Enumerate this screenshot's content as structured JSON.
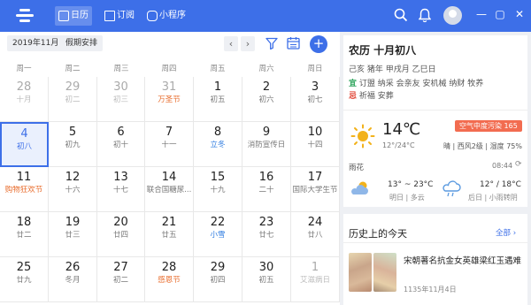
{
  "app": {
    "tabs": [
      {
        "label": "日历",
        "icon": "calendar-check-icon"
      },
      {
        "label": "订阅",
        "icon": "subscribe-icon"
      },
      {
        "label": "小程序",
        "icon": "mini-program-icon"
      }
    ],
    "window_buttons": {
      "minimize": "—",
      "restore": "▢",
      "close": "✕"
    },
    "colors": {
      "brand": "#3d6fe8",
      "festival": "#e86b2b",
      "term": "#2d7be0"
    }
  },
  "toolbar": {
    "month": "2019年11月",
    "holiday": "假期安排",
    "prev": "‹",
    "next": "›",
    "add": "+"
  },
  "weekdays": [
    "周一",
    "周二",
    "周三",
    "周四",
    "周五",
    "周六",
    "周日"
  ],
  "calendar": {
    "rows": [
      [
        {
          "num": "28",
          "lun": "十月",
          "dim": true
        },
        {
          "num": "29",
          "lun": "初二",
          "dim": true
        },
        {
          "num": "30",
          "lun": "初三",
          "dim": true
        },
        {
          "num": "31",
          "lun": "万圣节",
          "dim": true,
          "style": "red"
        },
        {
          "num": "1",
          "lun": "初五"
        },
        {
          "num": "2",
          "lun": "初六"
        },
        {
          "num": "3",
          "lun": "初七"
        }
      ],
      [
        {
          "num": "4",
          "lun": "初八",
          "sel": true
        },
        {
          "num": "5",
          "lun": "初九"
        },
        {
          "num": "6",
          "lun": "初十"
        },
        {
          "num": "7",
          "lun": "十一"
        },
        {
          "num": "8",
          "lun": "立冬",
          "style": "blue"
        },
        {
          "num": "9",
          "lun": "消防宣传日"
        },
        {
          "num": "10",
          "lun": "十四"
        }
      ],
      [
        {
          "num": "11",
          "lun": "购物狂欢节",
          "style": "red"
        },
        {
          "num": "12",
          "lun": "十六"
        },
        {
          "num": "13",
          "lun": "十七"
        },
        {
          "num": "14",
          "lun": "联合国糖尿..."
        },
        {
          "num": "15",
          "lun": "十九"
        },
        {
          "num": "16",
          "lun": "二十"
        },
        {
          "num": "17",
          "lun": "国际大学生节"
        }
      ],
      [
        {
          "num": "18",
          "lun": "廿二"
        },
        {
          "num": "19",
          "lun": "廿三"
        },
        {
          "num": "20",
          "lun": "廿四"
        },
        {
          "num": "21",
          "lun": "廿五"
        },
        {
          "num": "22",
          "lun": "小雪",
          "style": "blue"
        },
        {
          "num": "23",
          "lun": "廿七"
        },
        {
          "num": "24",
          "lun": "廿八"
        }
      ],
      [
        {
          "num": "25",
          "lun": "廿九"
        },
        {
          "num": "26",
          "lun": "冬月"
        },
        {
          "num": "27",
          "lun": "初二"
        },
        {
          "num": "28",
          "lun": "感恩节",
          "style": "red"
        },
        {
          "num": "29",
          "lun": "初四"
        },
        {
          "num": "30",
          "lun": "初五"
        },
        {
          "num": "1",
          "lun": "艾滋病日",
          "dim": true
        }
      ]
    ]
  },
  "detail": {
    "lunar_title": "农历 十月初八",
    "ganzhi": "己亥 猪年 甲戌月 乙巳日",
    "yi_label": "宜",
    "yi_text": "订盟 纳采 会亲友 安机械 纳财 牧养",
    "ji_label": "忌",
    "ji_text": "祈福 安葬"
  },
  "weather": {
    "temp": "14℃",
    "range": "12°/24°C",
    "desc": "晴 | 西风2级 | 湿度 75%",
    "aqi": "空气中度污染 165",
    "city": "雨花",
    "time": "08:44",
    "refresh": "⟳",
    "tomorrow_range": "13° ~ 23°C",
    "tomorrow_desc": "明日 | 多云",
    "after_range": "12° / 18°C",
    "after_desc": "后日 | 小雨转阴"
  },
  "history": {
    "title": "历史上的今天",
    "more": "全部 ›",
    "item_title": "宋朝著名抗金女英雄梁红玉遇难",
    "item_date": "1135年11月4日"
  }
}
